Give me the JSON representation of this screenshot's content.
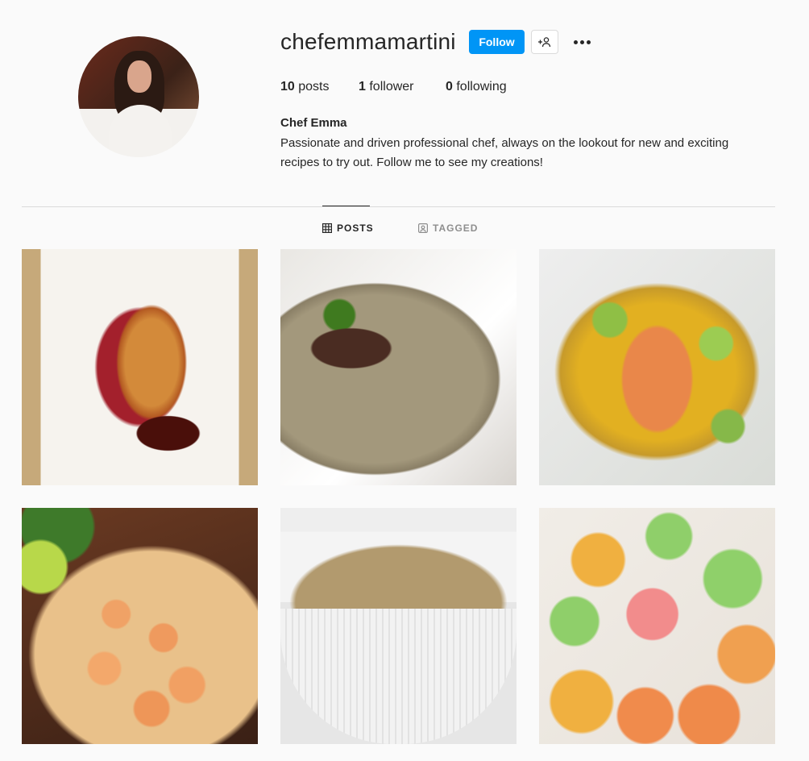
{
  "profile": {
    "username": "chefemmamartini",
    "follow_label": "Follow",
    "stats": {
      "posts_count": "10",
      "posts_label": "posts",
      "followers_count": "1",
      "followers_label": "follower",
      "following_count": "0",
      "following_label": "following"
    },
    "full_name": "Chef Emma",
    "bio": "Passionate and driven professional chef, always on the lookout for new and exciting recipes to try out. Follow me to see my creations!"
  },
  "tabs": [
    {
      "label": "POSTS",
      "icon": "grid-icon",
      "active": true
    },
    {
      "label": "TAGGED",
      "icon": "tagged-icon",
      "active": false
    }
  ],
  "posts": [
    {
      "subject": "roast-chicken-plate"
    },
    {
      "subject": "beef-soup-bowl"
    },
    {
      "subject": "salmon-avocado-plate"
    },
    {
      "subject": "grilled-shrimp-platter"
    },
    {
      "subject": "grain-salad-bowl"
    },
    {
      "subject": "sushi-rolls"
    }
  ],
  "colors": {
    "accent": "#0095f6",
    "text": "#262626",
    "muted": "#8e8e8e",
    "background": "#fafafa",
    "divider": "#dbdbdb"
  }
}
